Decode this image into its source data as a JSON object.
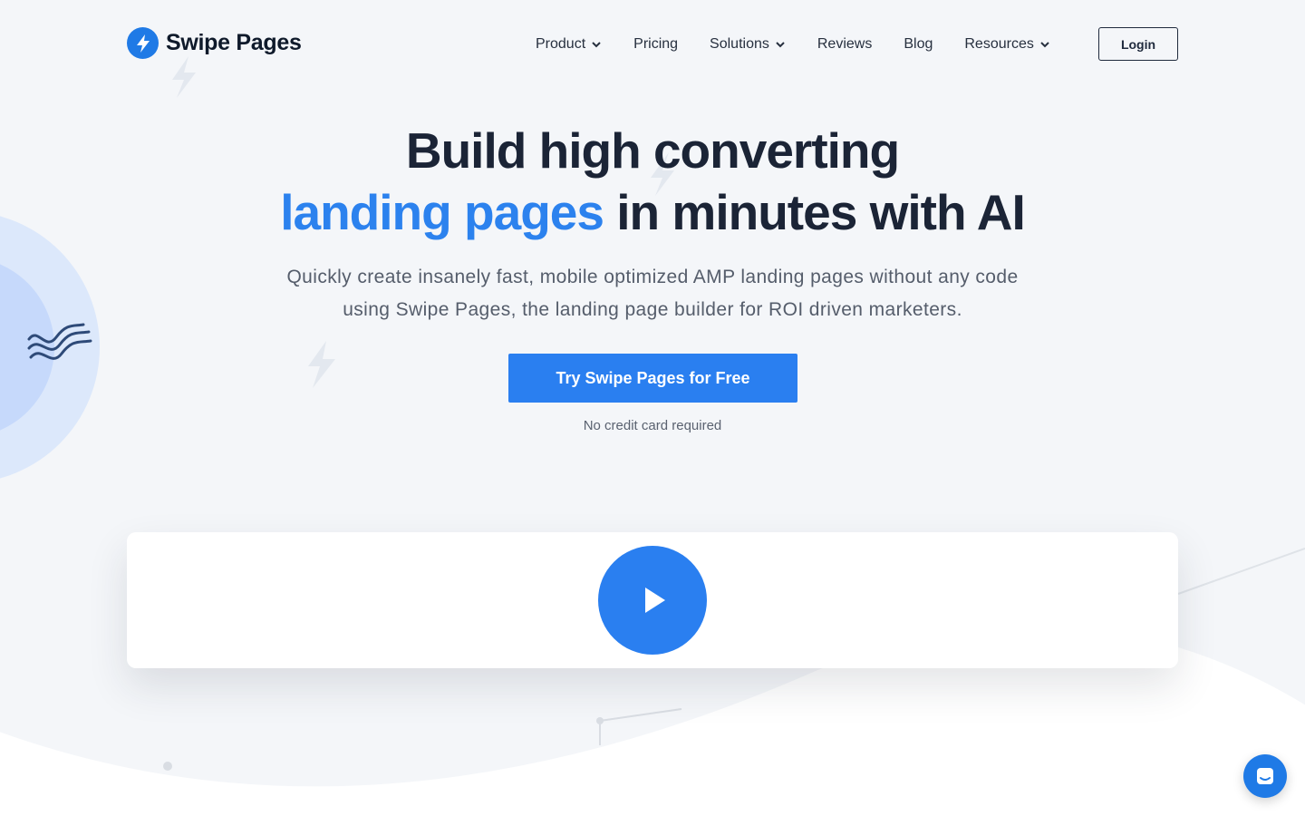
{
  "brand": {
    "name": "Swipe Pages",
    "color": "#1f7ae6",
    "icon": "bolt-icon"
  },
  "nav": {
    "items": [
      {
        "label": "Product",
        "has_dropdown": true
      },
      {
        "label": "Pricing",
        "has_dropdown": false
      },
      {
        "label": "Solutions",
        "has_dropdown": true
      },
      {
        "label": "Reviews",
        "has_dropdown": false
      },
      {
        "label": "Blog",
        "has_dropdown": false
      },
      {
        "label": "Resources",
        "has_dropdown": true
      }
    ],
    "login_label": "Login"
  },
  "hero": {
    "title_line1": "Build high converting",
    "title_accent": "landing pages",
    "title_rest": " in minutes with AI",
    "subtitle_line1": "Quickly create insanely fast, mobile optimized AMP landing pages without any code",
    "subtitle_line2": "using Swipe Pages, the landing page builder for ROI driven marketers.",
    "cta_label": "Try Swipe Pages for Free",
    "cta_note": "No credit card required",
    "accent_color": "#2c82ee"
  },
  "video": {
    "icon": "play-icon"
  },
  "chat": {
    "icon": "chat-icon"
  }
}
